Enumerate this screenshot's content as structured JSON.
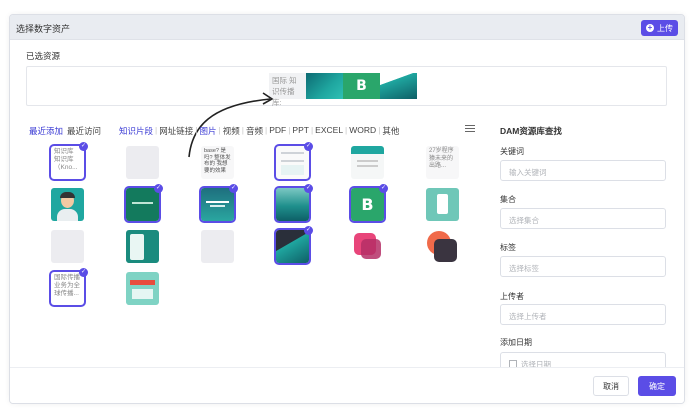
{
  "dialog": {
    "title": "选择数字资产",
    "upload_label": "上传"
  },
  "selected": {
    "label": "已选资源",
    "items": [
      {
        "type": "text",
        "text": "国际 知识传播 库:"
      },
      {
        "type": "image",
        "icon": "teal-gradient-slide"
      },
      {
        "type": "image",
        "icon": "green-b-logo"
      },
      {
        "type": "image",
        "icon": "bridge-photo"
      }
    ]
  },
  "tabs": {
    "recent_added": "最近添加",
    "recent_visited": "最近访问",
    "categories": [
      "知识片段",
      "网址链接",
      "图片",
      "视频",
      "音频",
      "PDF",
      "PPT",
      "EXCEL",
      "WORD",
      "其他"
    ],
    "active_category": "图片"
  },
  "assets": [
    {
      "kind": "text",
      "text": "知识库 知识库（Kno...",
      "selected": true
    },
    {
      "kind": "blank",
      "selected": false
    },
    {
      "kind": "text-small",
      "text": "base? 是吗? 整体发布的 我想要的效果",
      "selected": false
    },
    {
      "kind": "image",
      "icon": "document-preview",
      "selected": true
    },
    {
      "kind": "image",
      "icon": "teal-header-slide",
      "selected": false
    },
    {
      "kind": "text",
      "text": "27岁程序猿未来的出路...",
      "selected": false
    },
    {
      "kind": "image",
      "icon": "avatar-illustration",
      "selected": false
    },
    {
      "kind": "image",
      "icon": "green-slide",
      "selected": true
    },
    {
      "kind": "image",
      "icon": "teal-title-slide",
      "selected": true
    },
    {
      "kind": "image",
      "icon": "ocean-slide",
      "selected": true
    },
    {
      "kind": "image",
      "icon": "green-b-logo",
      "selected": true
    },
    {
      "kind": "image",
      "icon": "teal-phone-illustration",
      "selected": false
    },
    {
      "kind": "blank",
      "selected": false
    },
    {
      "kind": "image",
      "icon": "phone-screenshot",
      "selected": false
    },
    {
      "kind": "blank",
      "selected": false
    },
    {
      "kind": "image",
      "icon": "bridge-photo",
      "selected": true
    },
    {
      "kind": "image",
      "icon": "pink-app-icon",
      "selected": false
    },
    {
      "kind": "image",
      "icon": "orange-dark-app-icon",
      "selected": false
    },
    {
      "kind": "text",
      "text": "国际传播业务为全球传播...",
      "selected": true
    },
    {
      "kind": "image",
      "icon": "teal-banner-illustration",
      "selected": false
    }
  ],
  "right_panel": {
    "title": "DAM资源库查找",
    "keyword_label": "关键词",
    "keyword_placeholder": "输入关键词",
    "collection_label": "集合",
    "collection_placeholder": "选择集合",
    "tag_label": "标签",
    "tag_placeholder": "选择标签",
    "uploader_label": "上传者",
    "uploader_placeholder": "选择上传者",
    "date_label": "添加日期",
    "date_placeholder": "选择日期"
  },
  "footer": {
    "cancel_label": "取消",
    "confirm_label": "确定"
  },
  "colors": {
    "accent": "#5b4de6",
    "teal": "#1fa7a0",
    "green": "#2aa66b"
  }
}
